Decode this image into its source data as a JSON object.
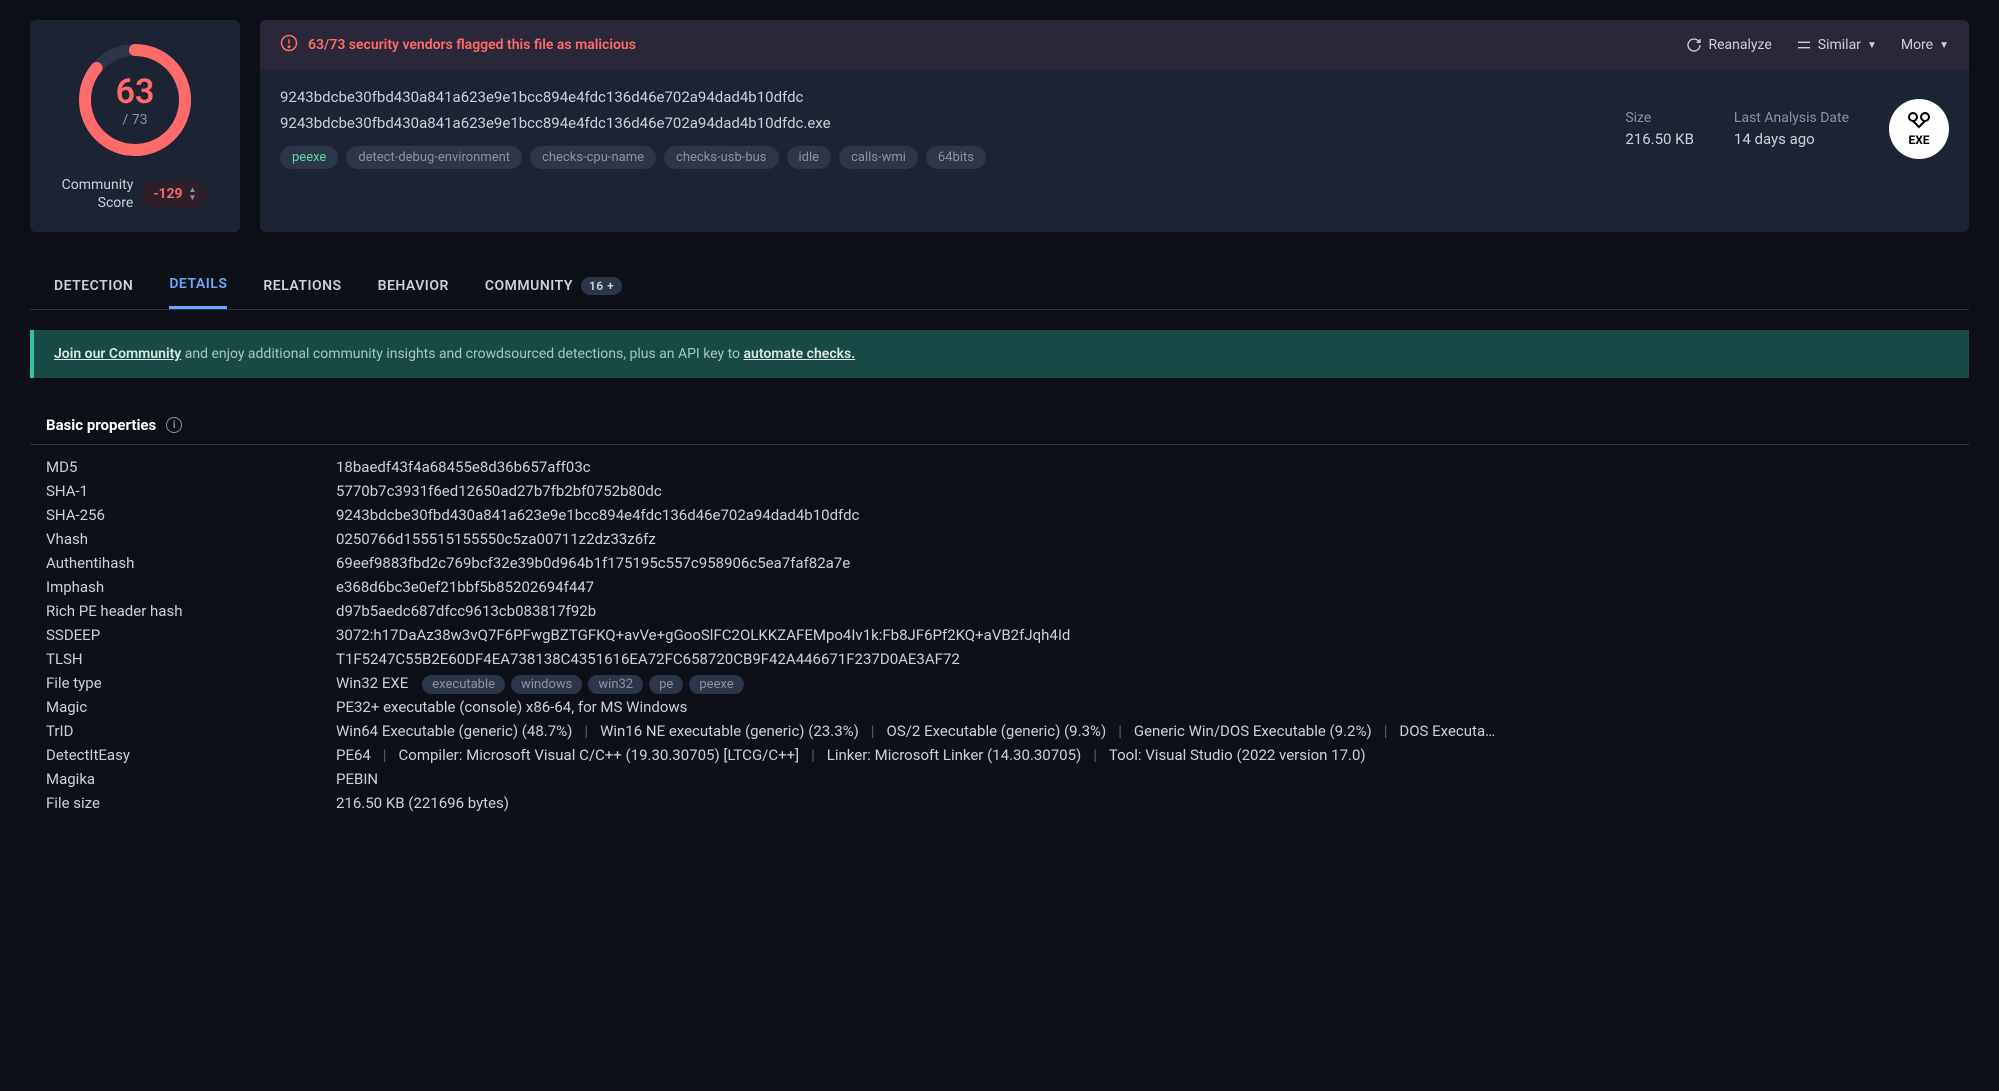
{
  "score": {
    "detections": "63",
    "total": "/ 73",
    "community_label": "Community\nScore",
    "community_score": "-129"
  },
  "alert": {
    "text": "63/73 security vendors flagged this file as malicious"
  },
  "actions": {
    "reanalyze": "Reanalyze",
    "similar": "Similar",
    "more": "More"
  },
  "file": {
    "hash": "9243bdcbe30fbd430a841a623e9e1bcc894e4fdc136d46e702a94dad4b10dfdc",
    "name": "9243bdcbe30fbd430a841a623e9e1bcc894e4fdc136d46e702a94dad4b10dfdc.exe",
    "tags": [
      "peexe",
      "detect-debug-environment",
      "checks-cpu-name",
      "checks-usb-bus",
      "idle",
      "calls-wmi",
      "64bits"
    ],
    "size_label": "Size",
    "size_value": "216.50 KB",
    "date_label": "Last Analysis Date",
    "date_value": "14 days ago",
    "icon_label": "EXE"
  },
  "tabs": {
    "detection": "DETECTION",
    "details": "DETAILS",
    "relations": "RELATIONS",
    "behavior": "BEHAVIOR",
    "community": "COMMUNITY",
    "community_count": "16 +"
  },
  "banner": {
    "link1": "Join our Community",
    "mid": " and enjoy additional community insights and crowdsourced detections, plus an API key to ",
    "link2": "automate checks."
  },
  "section": {
    "title": "Basic properties"
  },
  "props": {
    "md5_k": "MD5",
    "md5_v": "18baedf43f4a68455e8d36b657aff03c",
    "sha1_k": "SHA-1",
    "sha1_v": "5770b7c3931f6ed12650ad27b7fb2bf0752b80dc",
    "sha256_k": "SHA-256",
    "sha256_v": "9243bdcbe30fbd430a841a623e9e1bcc894e4fdc136d46e702a94dad4b10dfdc",
    "vhash_k": "Vhash",
    "vhash_v": "0250766d155515155550c5za00711z2dz33z6fz",
    "auth_k": "Authentihash",
    "auth_v": "69eef9883fbd2c769bcf32e39b0d964b1f175195c557c958906c5ea7faf82a7e",
    "imp_k": "Imphash",
    "imp_v": "e368d6bc3e0ef21bbf5b85202694f447",
    "rich_k": "Rich PE header hash",
    "rich_v": "d97b5aedc687dfcc9613cb083817f92b",
    "ssdeep_k": "SSDEEP",
    "ssdeep_v": "3072:h17DaAz38w3vQ7F6PFwgBZTGFKQ+avVe+gGooSlFC2OLKKZAFEMpo4Iv1k:Fb8JF6Pf2KQ+aVB2fJqh4Id",
    "tlsh_k": "TLSH",
    "tlsh_v": "T1F5247C55B2E60DF4EA738138C4351616EA72FC658720CB9F42A446671F237D0AE3AF72",
    "ftype_k": "File type",
    "ftype_v": "Win32 EXE",
    "ftype_tags": [
      "executable",
      "windows",
      "win32",
      "pe",
      "peexe"
    ],
    "magic_k": "Magic",
    "magic_v": "PE32+ executable (console) x86-64, for MS Windows",
    "trid_k": "TrID",
    "trid_items": [
      "Win64 Executable (generic) (48.7%)",
      "Win16 NE executable (generic) (23.3%)",
      "OS/2 Executable (generic) (9.3%)",
      "Generic Win/DOS Executable (9.2%)",
      "DOS Executa…"
    ],
    "die_k": "DetectItEasy",
    "die_items": [
      "PE64",
      "Compiler: Microsoft Visual C/C++ (19.30.30705) [LTCG/C++]",
      "Linker: Microsoft Linker (14.30.30705)",
      "Tool: Visual Studio (2022 version 17.0)"
    ],
    "magika_k": "Magika",
    "magika_v": "PEBIN",
    "fsize_k": "File size",
    "fsize_v": "216.50 KB (221696 bytes)"
  }
}
